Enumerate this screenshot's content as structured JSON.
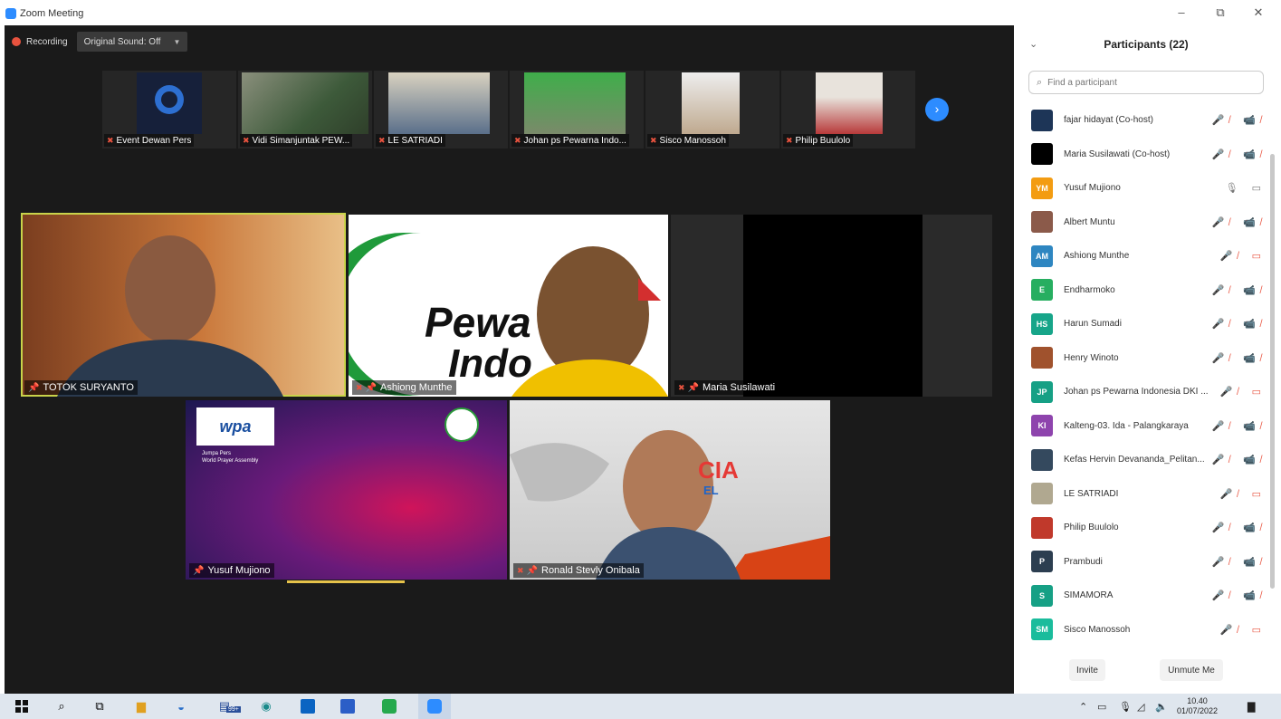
{
  "window": {
    "title": "Zoom Meeting",
    "minimize": "–",
    "restore": "⧉",
    "close": "✕"
  },
  "meeting": {
    "recording_label": "Recording",
    "sound_button": "Original Sound: Off",
    "next_page": "›",
    "thumbnails": [
      {
        "name": "Event Dewan Pers"
      },
      {
        "name": "Vidi Simanjuntak PEW..."
      },
      {
        "name": "LE SATRIADI"
      },
      {
        "name": "Johan ps Pewarna Indo..."
      },
      {
        "name": "Sisco Manossoh"
      },
      {
        "name": "Philip Buulolo"
      }
    ],
    "tiles": {
      "totok": {
        "name": "TOTOK SURYANTO"
      },
      "ashiong": {
        "name": "Ashiong Munthe",
        "bg_text": "Pewa",
        "bg_text2": "Indo"
      },
      "maria": {
        "name": "Maria Susilawati"
      },
      "yusuf": {
        "name": "Yusuf Mujiono",
        "logo": "wpa",
        "caption1": "Jumpa Pers",
        "caption2": "World Prayer Assembly"
      },
      "ronald": {
        "name": "Ronald Stevly Onibala",
        "bg_text": "CIA",
        "bg_text2": "EL"
      }
    }
  },
  "participants": {
    "title": "Participants (22)",
    "search_placeholder": "Find a participant",
    "list": [
      {
        "name": "fajar hidayat (Co-host)",
        "initials": "",
        "color": "#1d3557",
        "icons": "🎤̸ 📹̸",
        "muted": true
      },
      {
        "name": "Maria Susilawati (Co-host)",
        "initials": "",
        "color": "#000000",
        "icons": "🎤̸ 📹̸",
        "muted": true
      },
      {
        "name": "Yusuf Mujiono",
        "initials": "YM",
        "color": "#f39c12",
        "icons": "🎙 ▭",
        "muted": false
      },
      {
        "name": "Albert Muntu",
        "initials": "",
        "color": "#8b5a4a",
        "icons": "🎤̸ 📹̸",
        "muted": true
      },
      {
        "name": "Ashiong Munthe",
        "initials": "AM",
        "color": "#2e86c1",
        "icons": "🎤̸ ▭",
        "muted": true
      },
      {
        "name": "Endharmoko",
        "initials": "E",
        "color": "#27ae60",
        "icons": "🎤̸ 📹̸",
        "muted": true
      },
      {
        "name": "Harun Sumadi",
        "initials": "HS",
        "color": "#17a589",
        "icons": "🎤̸ 📹̸",
        "muted": true
      },
      {
        "name": "Henry Winoto",
        "initials": "",
        "color": "#a0522d",
        "icons": "🎤̸ 📹̸",
        "muted": true
      },
      {
        "name": "Johan ps Pewarna Indonesia DKI ...",
        "initials": "JP",
        "color": "#16a085",
        "icons": "🎤̸ ▭",
        "muted": true
      },
      {
        "name": "Kalteng-03. Ida - Palangkaraya",
        "initials": "KI",
        "color": "#8e44ad",
        "icons": "🎤̸ 📹̸",
        "muted": true
      },
      {
        "name": "Kefas Hervin Devananda_Pelitan...",
        "initials": "",
        "color": "#34495e",
        "icons": "🎤̸ 📹̸",
        "muted": true
      },
      {
        "name": "LE SATRIADI",
        "initials": "",
        "color": "#b0a890",
        "icons": "🎤̸ ▭",
        "muted": true
      },
      {
        "name": "Philip Buulolo",
        "initials": "",
        "color": "#c0392b",
        "icons": "🎤̸ 📹̸",
        "muted": true
      },
      {
        "name": "Prambudi",
        "initials": "P",
        "color": "#2c3e50",
        "icons": "🎤̸ 📹̸",
        "muted": true
      },
      {
        "name": "SIMAMORA",
        "initials": "S",
        "color": "#16a085",
        "icons": "🎤̸ 📹̸",
        "muted": true
      },
      {
        "name": "Sisco Manossoh",
        "initials": "SM",
        "color": "#1abc9c",
        "icons": "🎤̸ ▭",
        "muted": true
      }
    ],
    "invite_label": "Invite",
    "unmute_label": "Unmute Me"
  },
  "taskbar": {
    "time": "10.40",
    "date": "01/07/2022",
    "badge": "99+"
  }
}
